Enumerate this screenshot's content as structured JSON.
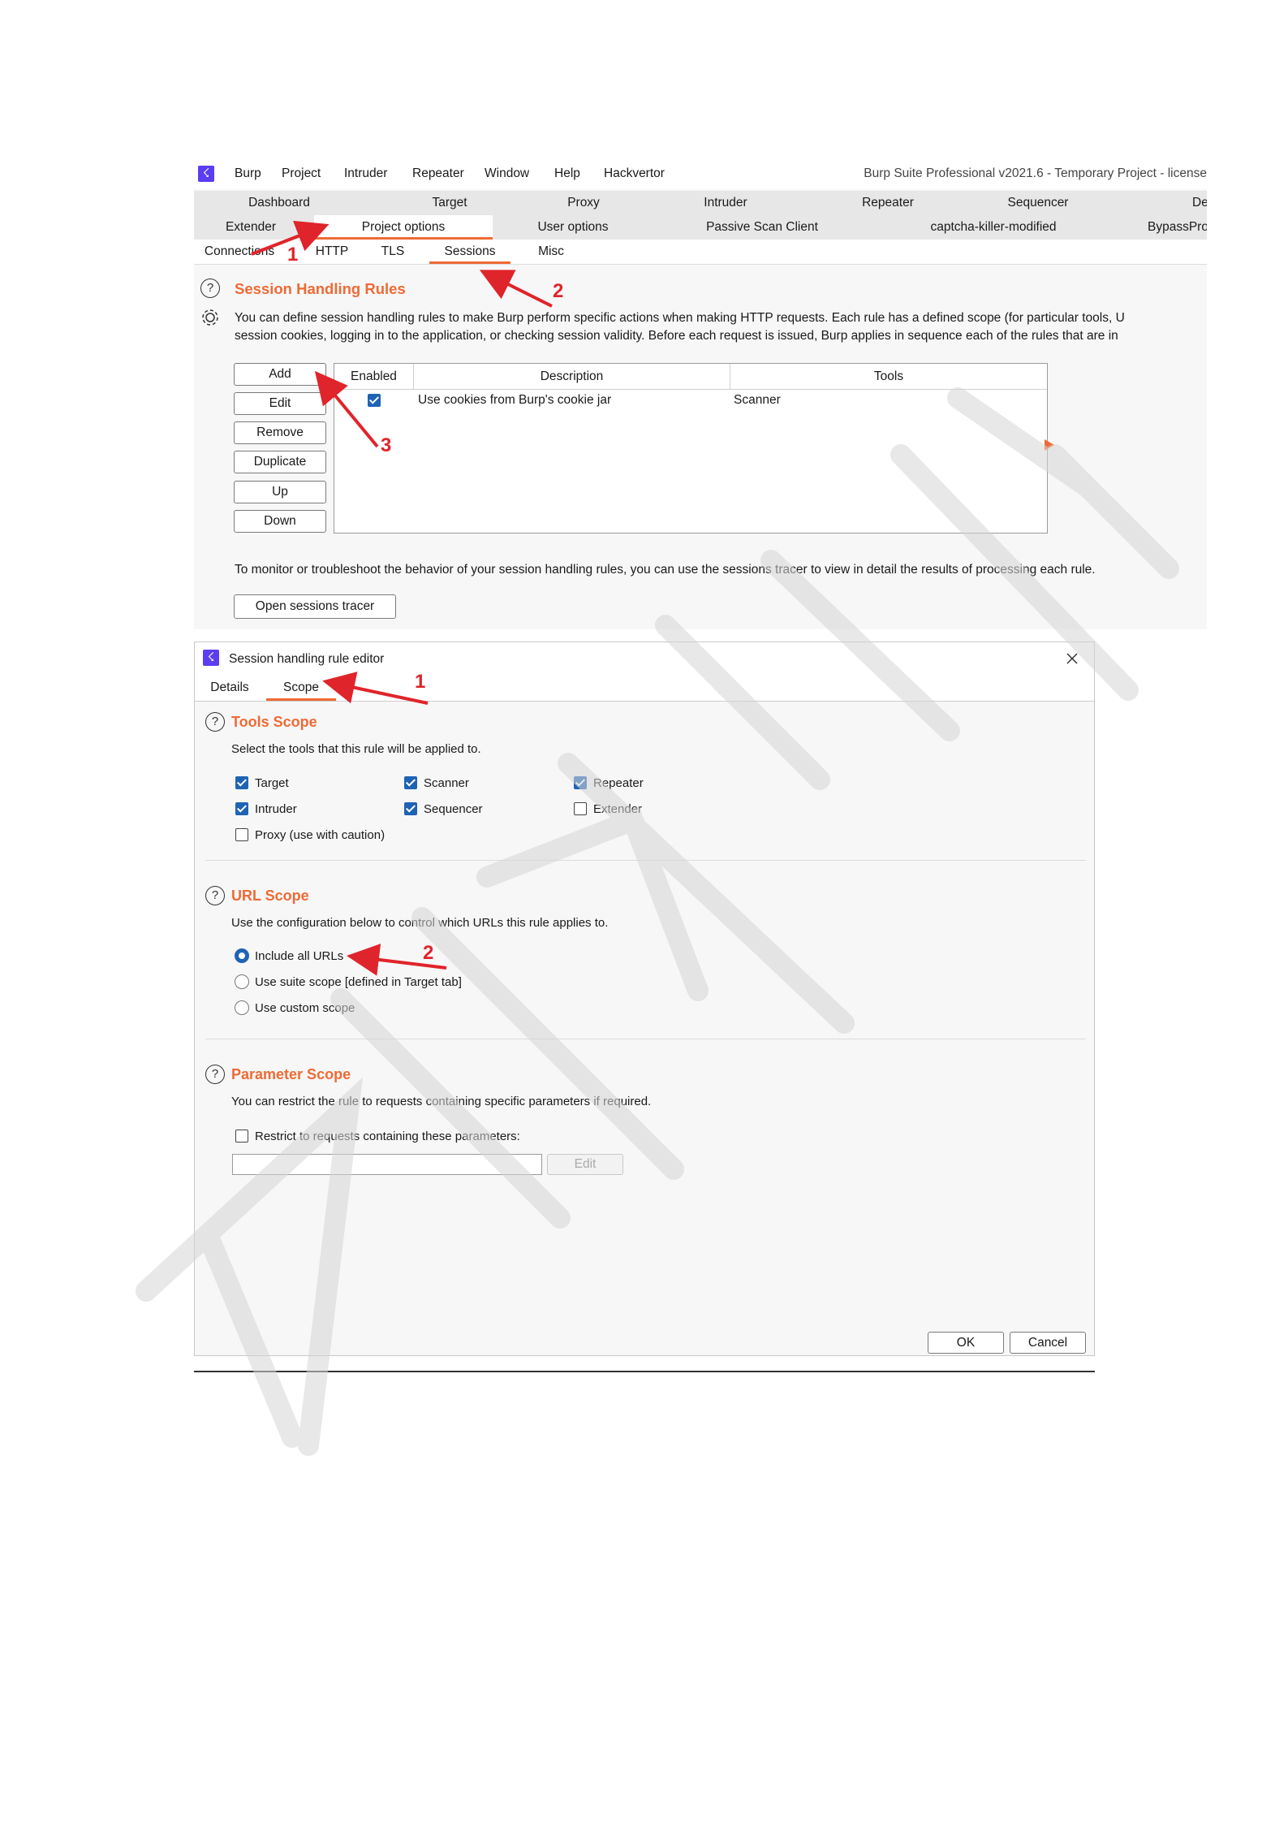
{
  "main_window": {
    "menu": [
      "Burp",
      "Project",
      "Intruder",
      "Repeater",
      "Window",
      "Help",
      "Hackvertor"
    ],
    "title": "Burp Suite Professional v2021.6 - Temporary Project - license",
    "tabs_row1": [
      "Dashboard",
      "Target",
      "Proxy",
      "Intruder",
      "Repeater",
      "Sequencer",
      "De"
    ],
    "tabs_row2": [
      "Extender",
      "Project options",
      "User options",
      "Passive Scan Client",
      "captcha-killer-modified",
      "BypassPro"
    ],
    "subtabs": [
      "Connections",
      "HTTP",
      "TLS",
      "Sessions",
      "Misc"
    ],
    "section_title": "Session Handling Rules",
    "description_line1": "You can define session handling rules to make Burp perform specific actions when making HTTP requests. Each rule has a defined scope (for particular tools, U",
    "description_line2": "session cookies, logging in to the application, or checking session validity. Before each request is issued, Burp applies in sequence each of the rules that are in",
    "buttons": [
      "Add",
      "Edit",
      "Remove",
      "Duplicate",
      "Up",
      "Down"
    ],
    "table": {
      "headers": [
        "Enabled",
        "Description",
        "Tools"
      ],
      "rows": [
        {
          "enabled": true,
          "description": "Use cookies from Burp's cookie jar",
          "tools": "Scanner"
        }
      ]
    },
    "monitor_text": "To monitor or troubleshoot the behavior of your session handling rules, you can use the sessions tracer to view in detail the results of processing each rule.",
    "tracer_button": "Open sessions tracer"
  },
  "editor": {
    "title": "Session handling rule editor",
    "tabs": [
      "Details",
      "Scope"
    ],
    "tools_scope": {
      "title": "Tools Scope",
      "desc": "Select the tools that this rule will be applied to.",
      "options": [
        {
          "label": "Target",
          "checked": true
        },
        {
          "label": "Scanner",
          "checked": true
        },
        {
          "label": "Repeater",
          "checked": true
        },
        {
          "label": "Intruder",
          "checked": true
        },
        {
          "label": "Sequencer",
          "checked": true
        },
        {
          "label": "Extender",
          "checked": false
        },
        {
          "label": "Proxy (use with caution)",
          "checked": false
        }
      ]
    },
    "url_scope": {
      "title": "URL Scope",
      "desc": "Use the configuration below to control which URLs this rule applies to.",
      "options": [
        {
          "label": "Include all URLs",
          "selected": true
        },
        {
          "label": "Use suite scope [defined in Target tab]",
          "selected": false
        },
        {
          "label": "Use custom scope",
          "selected": false
        }
      ]
    },
    "parameter_scope": {
      "title": "Parameter Scope",
      "desc": "You can restrict the rule to requests containing specific parameters if required.",
      "checkbox_label": "Restrict to requests containing these parameters:",
      "input_value": "",
      "edit_button": "Edit"
    },
    "ok_button": "OK",
    "cancel_button": "Cancel"
  },
  "annotations": [
    "1",
    "2",
    "3",
    "1",
    "2"
  ],
  "colors": {
    "accent": "#ef6a35",
    "annotation": "#e0242b",
    "check": "#1f63b5",
    "logo": "#5b3df2"
  }
}
